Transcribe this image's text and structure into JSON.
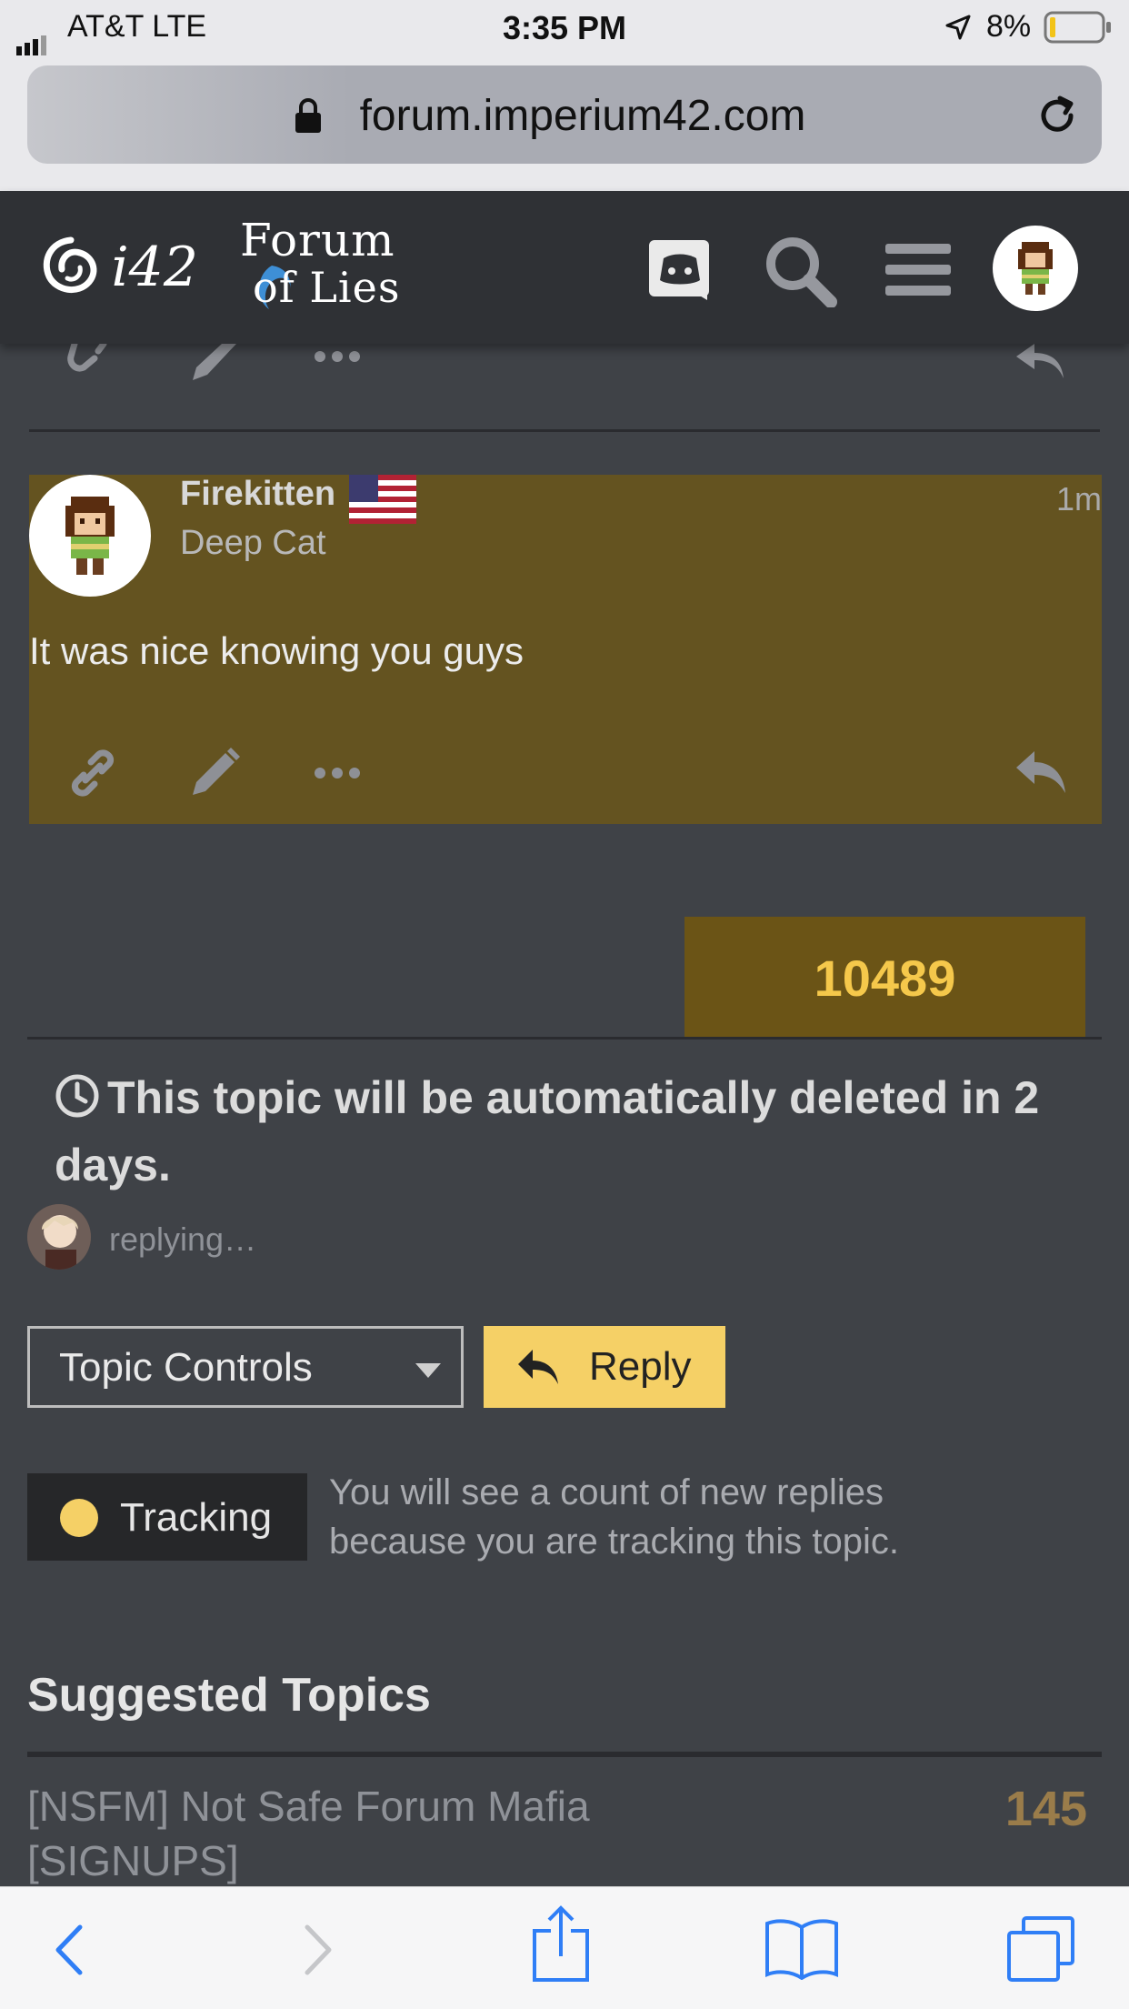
{
  "status_bar": {
    "carrier": "AT&T   LTE",
    "time": "3:35 PM",
    "battery": "8%"
  },
  "browser": {
    "url": "forum.imperium42.com"
  },
  "header": {
    "logo_text": "i42",
    "forum_logo_line1": "Forum",
    "forum_logo_line2": "of Lies",
    "icons": [
      "discord-icon",
      "search-icon",
      "menu-icon",
      "user-avatar"
    ]
  },
  "post": {
    "username": "Firekitten",
    "user_title": "Deep Cat",
    "time_ago": "1m",
    "body": "It was nice knowing you guys"
  },
  "post_counter": "10489",
  "topic_notice": "This topic will be automatically deleted in 2 days.",
  "replying_text": "replying…",
  "controls": {
    "topic_controls_label": "Topic Controls",
    "reply_label": "Reply"
  },
  "tracking": {
    "label": "Tracking",
    "description_line1": "You will see a count of new replies",
    "description_line2": "because you are tracking this topic."
  },
  "suggested": {
    "heading": "Suggested Topics",
    "items": [
      {
        "title_line1": "[NSFM] Not Safe Forum Mafia",
        "title_line2": "[SIGNUPS]",
        "count": "145"
      }
    ]
  },
  "colors": {
    "accent": "#f5d066",
    "highlight": "#645320",
    "background": "#3f4247"
  }
}
